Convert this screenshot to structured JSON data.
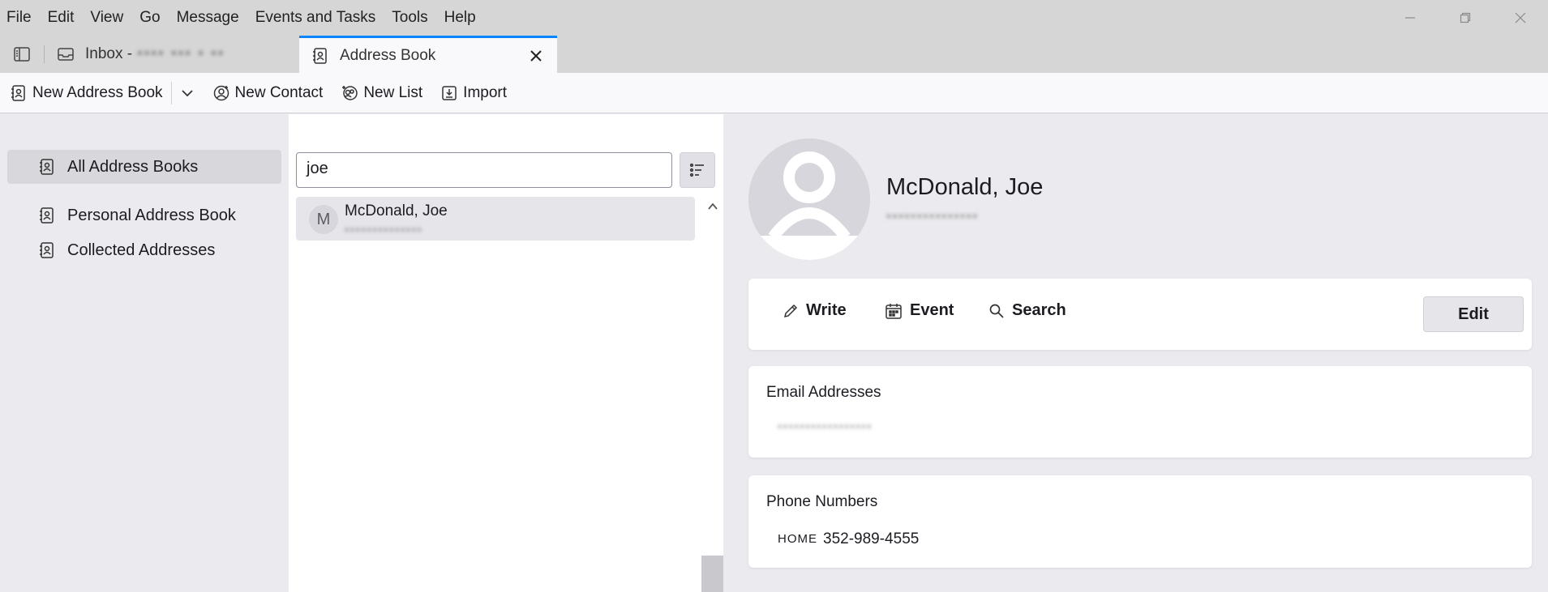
{
  "menu": [
    "File",
    "Edit",
    "View",
    "Go",
    "Message",
    "Events and Tasks",
    "Tools",
    "Help"
  ],
  "tabs": {
    "inbox_label": "Inbox -",
    "inbox_account": "•••• ••• • ••",
    "active_label": "Address Book"
  },
  "toolbar": {
    "new_address_book": "New Address Book",
    "new_contact": "New Contact",
    "new_list": "New List",
    "import": "Import"
  },
  "address_books": [
    "All Address Books",
    "Personal Address Book",
    "Collected Addresses"
  ],
  "search": {
    "value": "joe"
  },
  "contact_list": [
    {
      "initial": "M",
      "name": "McDonald, Joe",
      "email": "••••••••••••••"
    }
  ],
  "detail": {
    "name": "McDonald, Joe",
    "email_subtitle": "•••••••••••••••",
    "actions": {
      "write": "Write",
      "event": "Event",
      "search": "Search",
      "edit": "Edit"
    },
    "email_section_title": "Email Addresses",
    "email_value": "•••••••••••••••••",
    "phone_section_title": "Phone Numbers",
    "phone_type": "HOME",
    "phone_value": "352-989-4555"
  },
  "colors": {
    "accent": "#0a84ff",
    "selected_bg": "#d8d8dc",
    "panel_bg": "#ebebef"
  }
}
